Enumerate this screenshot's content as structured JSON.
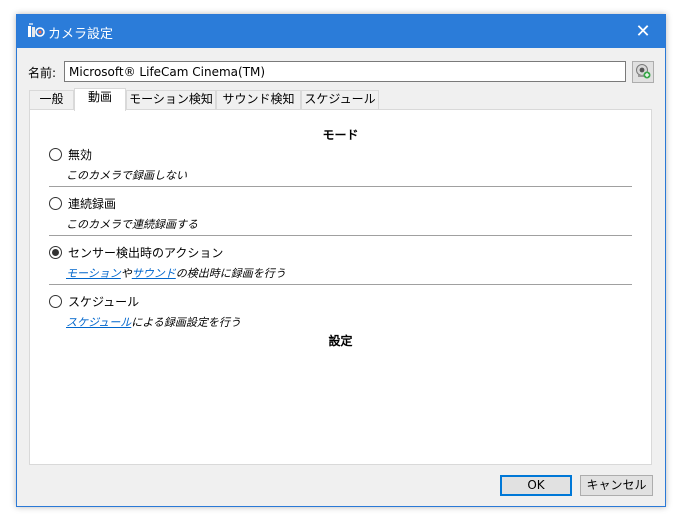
{
  "window": {
    "title": "カメラ設定",
    "close": "✕"
  },
  "name_row": {
    "label": "名前:",
    "value": "Microsoft® LifeCam Cinema(TM)"
  },
  "tabs": [
    {
      "label": "一般"
    },
    {
      "label": "動画"
    },
    {
      "label": "モーション検知"
    },
    {
      "label": "サウンド検知"
    },
    {
      "label": "スケジュール"
    }
  ],
  "mode": {
    "heading": "モード",
    "options": [
      {
        "label": "無効",
        "description": "このカメラで録画しない",
        "checked": false
      },
      {
        "label": "連続録画",
        "description": "このカメラで連続録画する",
        "checked": false
      },
      {
        "label": "センサー検出時のアクション",
        "link1": "モーション",
        "mid1": "や",
        "link2": "サウンド",
        "rest": "の検出時に録画を行う",
        "checked": true
      },
      {
        "label": "スケジュール",
        "link1": "スケジュール",
        "rest": "による録画設定を行う",
        "checked": false
      }
    ]
  },
  "settings": {
    "heading": "設定"
  },
  "buttons": {
    "ok": "OK",
    "cancel": "キャンセル"
  },
  "colors": {
    "titlebar": "#2b7cd9",
    "link": "#0066cc"
  },
  "icons": {
    "app": "camera-settings-icon",
    "camera_button": "webcam-add-icon"
  }
}
